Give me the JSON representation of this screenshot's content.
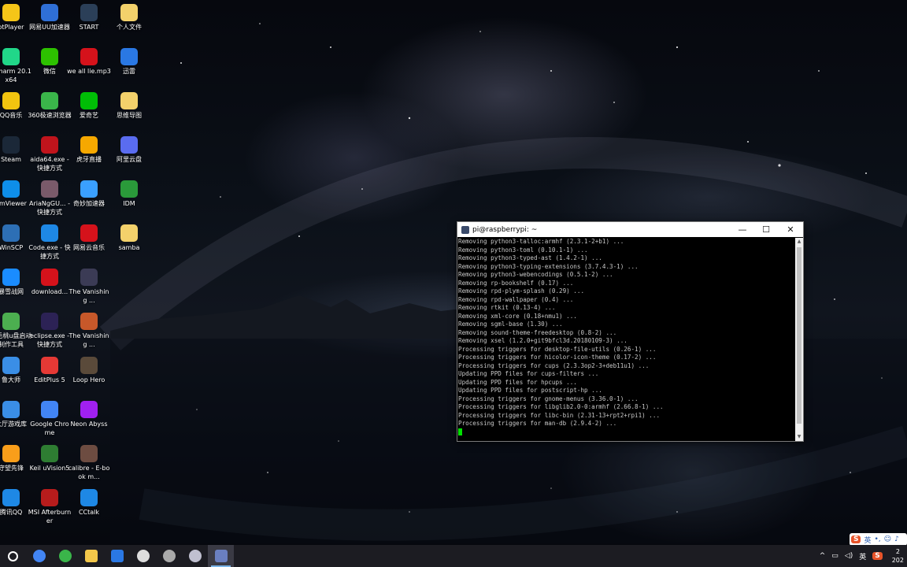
{
  "desktop": {
    "icons": [
      {
        "label": "otPlayer",
        "icon": "potplayer-icon",
        "color": "#f5c518"
      },
      {
        "label": "网易UU加速器",
        "icon": "uu-booster-icon",
        "color": "#2f6fd6"
      },
      {
        "label": "START",
        "icon": "start-icon",
        "color": "#2b3f58"
      },
      {
        "label": "个人文件",
        "icon": "folder-icon",
        "color": "#f3d16b"
      },
      {
        "label": "yCharm 20.1 x64",
        "icon": "pycharm-icon",
        "color": "#21d789"
      },
      {
        "label": "微信",
        "icon": "wechat-icon",
        "color": "#2dc100"
      },
      {
        "label": "we all lie.mp3",
        "icon": "netease-music-file-icon",
        "color": "#d5121b"
      },
      {
        "label": "迅雷",
        "icon": "xunlei-icon",
        "color": "#2a78e4"
      },
      {
        "label": "QQ音乐",
        "icon": "qqmusic-icon",
        "color": "#f2c40f"
      },
      {
        "label": "360极速浏览器",
        "icon": "360-browser-icon",
        "color": "#3ab54a"
      },
      {
        "label": "爱奇艺",
        "icon": "iqiyi-icon",
        "color": "#00be06"
      },
      {
        "label": "思维导图",
        "icon": "mindmap-icon",
        "color": "#f3d16b"
      },
      {
        "label": "Steam",
        "icon": "steam-icon",
        "color": "#1b2838"
      },
      {
        "label": "aida64.exe - 快捷方式",
        "icon": "aida64-icon",
        "color": "#c0141c"
      },
      {
        "label": "虎牙直播",
        "icon": "huya-icon",
        "color": "#f6a800"
      },
      {
        "label": "阿里云盘",
        "icon": "aliyun-drive-icon",
        "color": "#5a6cf0"
      },
      {
        "label": "amViewer",
        "icon": "teamviewer-icon",
        "color": "#0e8ee9"
      },
      {
        "label": "AriaNgGU... - 快捷方式",
        "icon": "ariang-icon",
        "color": "#7a5a6a"
      },
      {
        "label": "奇妙加速器",
        "icon": "qimiao-icon",
        "color": "#3aa0ff"
      },
      {
        "label": "IDM",
        "icon": "idm-icon",
        "color": "#2a9a3a"
      },
      {
        "label": "WinSCP",
        "icon": "winscp-icon",
        "color": "#2d6fb5"
      },
      {
        "label": "Code.exe - 快捷方式",
        "icon": "vscode-icon",
        "color": "#1e88e5"
      },
      {
        "label": "网易云音乐",
        "icon": "netease-music-icon",
        "color": "#d5121b"
      },
      {
        "label": "samba",
        "icon": "folder-icon",
        "color": "#f3d16b"
      },
      {
        "label": "暴雪战网",
        "icon": "battlenet-icon",
        "color": "#1a8cff"
      },
      {
        "label": "download...",
        "icon": "netease-music-file-icon",
        "color": "#d5121b"
      },
      {
        "label": "The Vanishing ...",
        "icon": "vanishing-icon",
        "color": "#3b3b55"
      },
      {
        "label": "",
        "icon": "blank-icon",
        "color": "transparent"
      },
      {
        "label": "老毛桃u盘启动制作工具",
        "icon": "usb-tool-icon",
        "color": "#4caf50"
      },
      {
        "label": "eclipse.exe - 快捷方式",
        "icon": "eclipse-icon",
        "color": "#2c2255"
      },
      {
        "label": "The Vanishing ...",
        "icon": "vanishing-icon",
        "color": "#c7582a"
      },
      {
        "label": "",
        "icon": "blank-icon",
        "color": "transparent"
      },
      {
        "label": "鲁大师",
        "icon": "ludashi-icon",
        "color": "#3a8ee6"
      },
      {
        "label": "EditPlus 5",
        "icon": "editplus-icon",
        "color": "#e53935"
      },
      {
        "label": "Loop Hero",
        "icon": "loophero-icon",
        "color": "#5a4a3a"
      },
      {
        "label": "",
        "icon": "blank-icon",
        "color": "transparent"
      },
      {
        "label": "大厅游戏库",
        "icon": "game-library-icon",
        "color": "#3a8ee6"
      },
      {
        "label": "Google Chrome",
        "icon": "chrome-icon",
        "color": "#4285f4"
      },
      {
        "label": "Neon Abyss",
        "icon": "neonabyss-icon",
        "color": "#a020f0"
      },
      {
        "label": "",
        "icon": "blank-icon",
        "color": "transparent"
      },
      {
        "label": "守望先锋",
        "icon": "overwatch-icon",
        "color": "#f99e1a"
      },
      {
        "label": "Keil uVision5",
        "icon": "keil-icon",
        "color": "#2e7d32"
      },
      {
        "label": "calibre - E-book m...",
        "icon": "calibre-icon",
        "color": "#6d4c41"
      },
      {
        "label": "",
        "icon": "blank-icon",
        "color": "transparent"
      },
      {
        "label": "腾讯QQ",
        "icon": "qq-icon",
        "color": "#1e88e5"
      },
      {
        "label": "MSI Afterburner",
        "icon": "msi-afterburner-icon",
        "color": "#b71c1c"
      },
      {
        "label": "CCtalk",
        "icon": "cctalk-icon",
        "color": "#1e88e5"
      },
      {
        "label": "",
        "icon": "blank-icon",
        "color": "transparent"
      }
    ]
  },
  "terminal": {
    "title": "pi@raspberrypi: ~",
    "minimize_label": "—",
    "maximize_label": "☐",
    "close_label": "✕",
    "lines": [
      "Removing python3-talloc:armhf (2.3.1-2+b1) ...",
      "Removing python3-toml (0.10.1-1) ...",
      "Removing python3-typed-ast (1.4.2-1) ...",
      "Removing python3-typing-extensions (3.7.4.3-1) ...",
      "Removing python3-webencodings (0.5.1-2) ...",
      "Removing rp-bookshelf (0.17) ...",
      "Removing rpd-plym-splash (0.29) ...",
      "Removing rpd-wallpaper (0.4) ...",
      "Removing rtkit (0.13-4) ...",
      "Removing xml-core (0.18+nmu1) ...",
      "Removing sgml-base (1.30) ...",
      "Removing sound-theme-freedesktop (0.8-2) ...",
      "Removing xsel (1.2.0+git9bfcl3d.20180109-3) ...",
      "Processing triggers for desktop-file-utils (0.26-1) ...",
      "Processing triggers for hicolor-icon-theme (0.17-2) ...",
      "Processing triggers for cups (2.3.3op2-3+deb11u1) ...",
      "Updating PPD files for cups-filters ...",
      "Updating PPD files for hpcups ...",
      "Updating PPD files for postscript-hp ...",
      "Processing triggers for gnome-menus (3.36.0-1) ...",
      "Processing triggers for libglib2.0-0:armhf (2.66.8-1) ...",
      "Processing triggers for libc-bin (2.31-13+rpt2+rpi1) ...",
      "Processing triggers for man-db (2.9.4-2) ..."
    ]
  },
  "taskbar": {
    "items": [
      {
        "name": "search-button",
        "icon": "search-circle-icon",
        "color": "#ffffff",
        "active": false
      },
      {
        "name": "chrome-taskbar",
        "icon": "chrome-icon",
        "color": "#4285f4",
        "active": false
      },
      {
        "name": "360-taskbar",
        "icon": "360-browser-icon",
        "color": "#3ab54a",
        "active": false
      },
      {
        "name": "explorer-taskbar",
        "icon": "folder-icon",
        "color": "#f3c74a",
        "active": false
      },
      {
        "name": "xunlei-taskbar",
        "icon": "xunlei-icon",
        "color": "#2a78e4",
        "active": false
      },
      {
        "name": "settings-taskbar",
        "icon": "gear-icon",
        "color": "#dddddd",
        "active": false
      },
      {
        "name": "steam-taskbar",
        "icon": "steam-icon",
        "color": "#aaaaaa",
        "active": false
      },
      {
        "name": "app-taskbar",
        "icon": "network-app-icon",
        "color": "#c0c0d0",
        "active": false
      },
      {
        "name": "putty-taskbar",
        "icon": "putty-icon",
        "color": "#6a7fc0",
        "active": true
      }
    ],
    "tray": {
      "chevron": "^",
      "lang": "英",
      "time": "2",
      "date": "202"
    },
    "ime": {
      "logo": "S",
      "mode": "英"
    }
  }
}
